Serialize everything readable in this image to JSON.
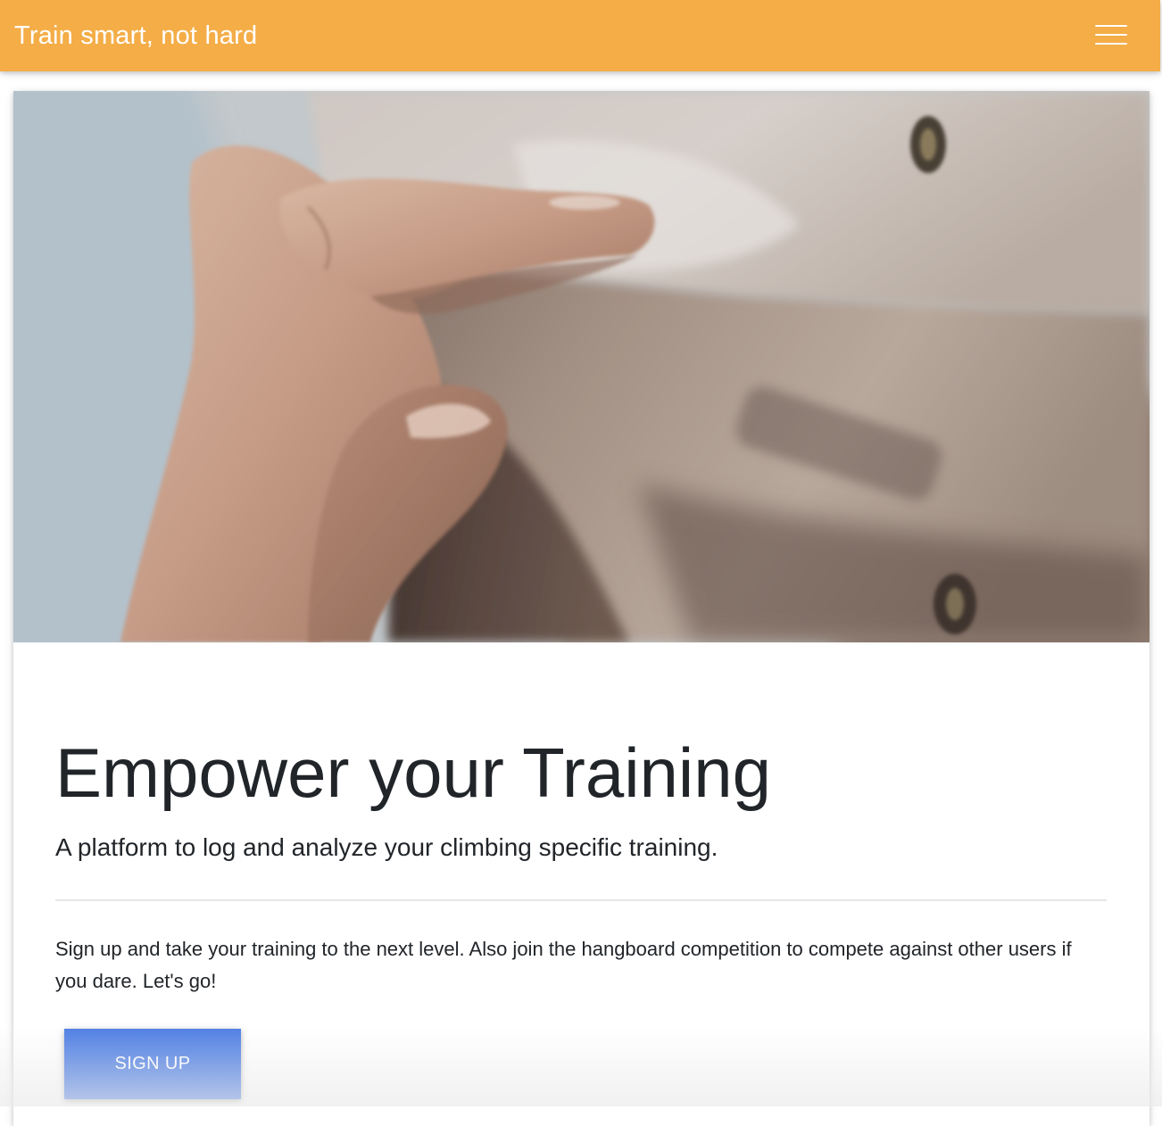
{
  "navbar": {
    "brand": "Train smart, not hard",
    "menu_icon": "hamburger-menu-icon",
    "background_color": "#f4ad47"
  },
  "hero": {
    "image_subject": "hand-gripping-hangboard"
  },
  "content": {
    "headline": "Empower your Training",
    "lead": "A platform to log and analyze your climbing specific training.",
    "body": "Sign up and take your training to the next level. Also join the hangboard competition to compete against other users if you dare. Let's go!",
    "signup_label": "SIGN UP",
    "signup_color": "#4f7fe4"
  }
}
